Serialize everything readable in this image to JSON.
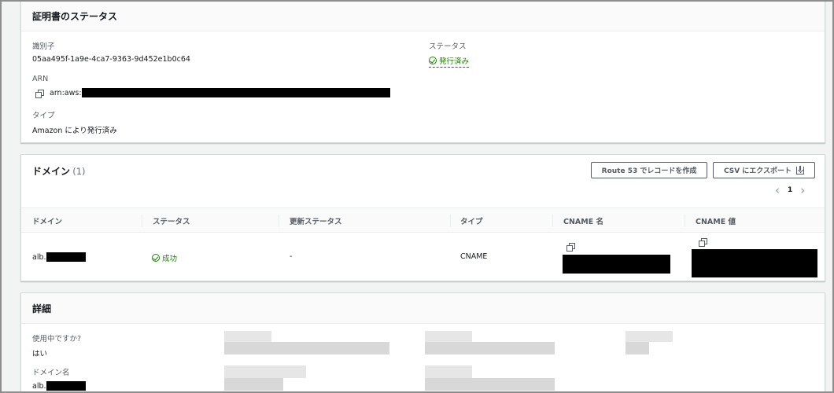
{
  "status_panel": {
    "title": "証明書のステータス",
    "identifier_label": "識別子",
    "identifier_value": "05aa495f-1a9e-4ca7-9363-9d452e1b0c64",
    "status_label": "ステータス",
    "status_value": "発行済み",
    "arn_label": "ARN",
    "arn_value": "arn:aws:",
    "type_label": "タイプ",
    "type_value": "Amazon により発行済み"
  },
  "domain_panel": {
    "title": "ドメイン",
    "count": "(1)",
    "route53_button": "Route 53 でレコードを作成",
    "csv_button": "CSV にエクスポート",
    "pagination": {
      "prev": "‹",
      "page": "1",
      "next": "›"
    },
    "columns": [
      "ドメイン",
      "ステータス",
      "更新ステータス",
      "タイプ",
      "CNAME 名",
      "CNAME 値"
    ],
    "row": {
      "domain": "alb.",
      "status": "成功",
      "renewal_status": "-",
      "type": "CNAME"
    }
  },
  "details_panel": {
    "title": "詳細",
    "in_use_label": "使用中ですか?",
    "in_use_value": "はい",
    "domain_name_label": "ドメイン名",
    "domain_name_value": "alb."
  },
  "colors": {
    "success": "#1d8102",
    "background": "#f2f3f3",
    "panel": "#ffffff",
    "border": "#d5dbdb"
  }
}
